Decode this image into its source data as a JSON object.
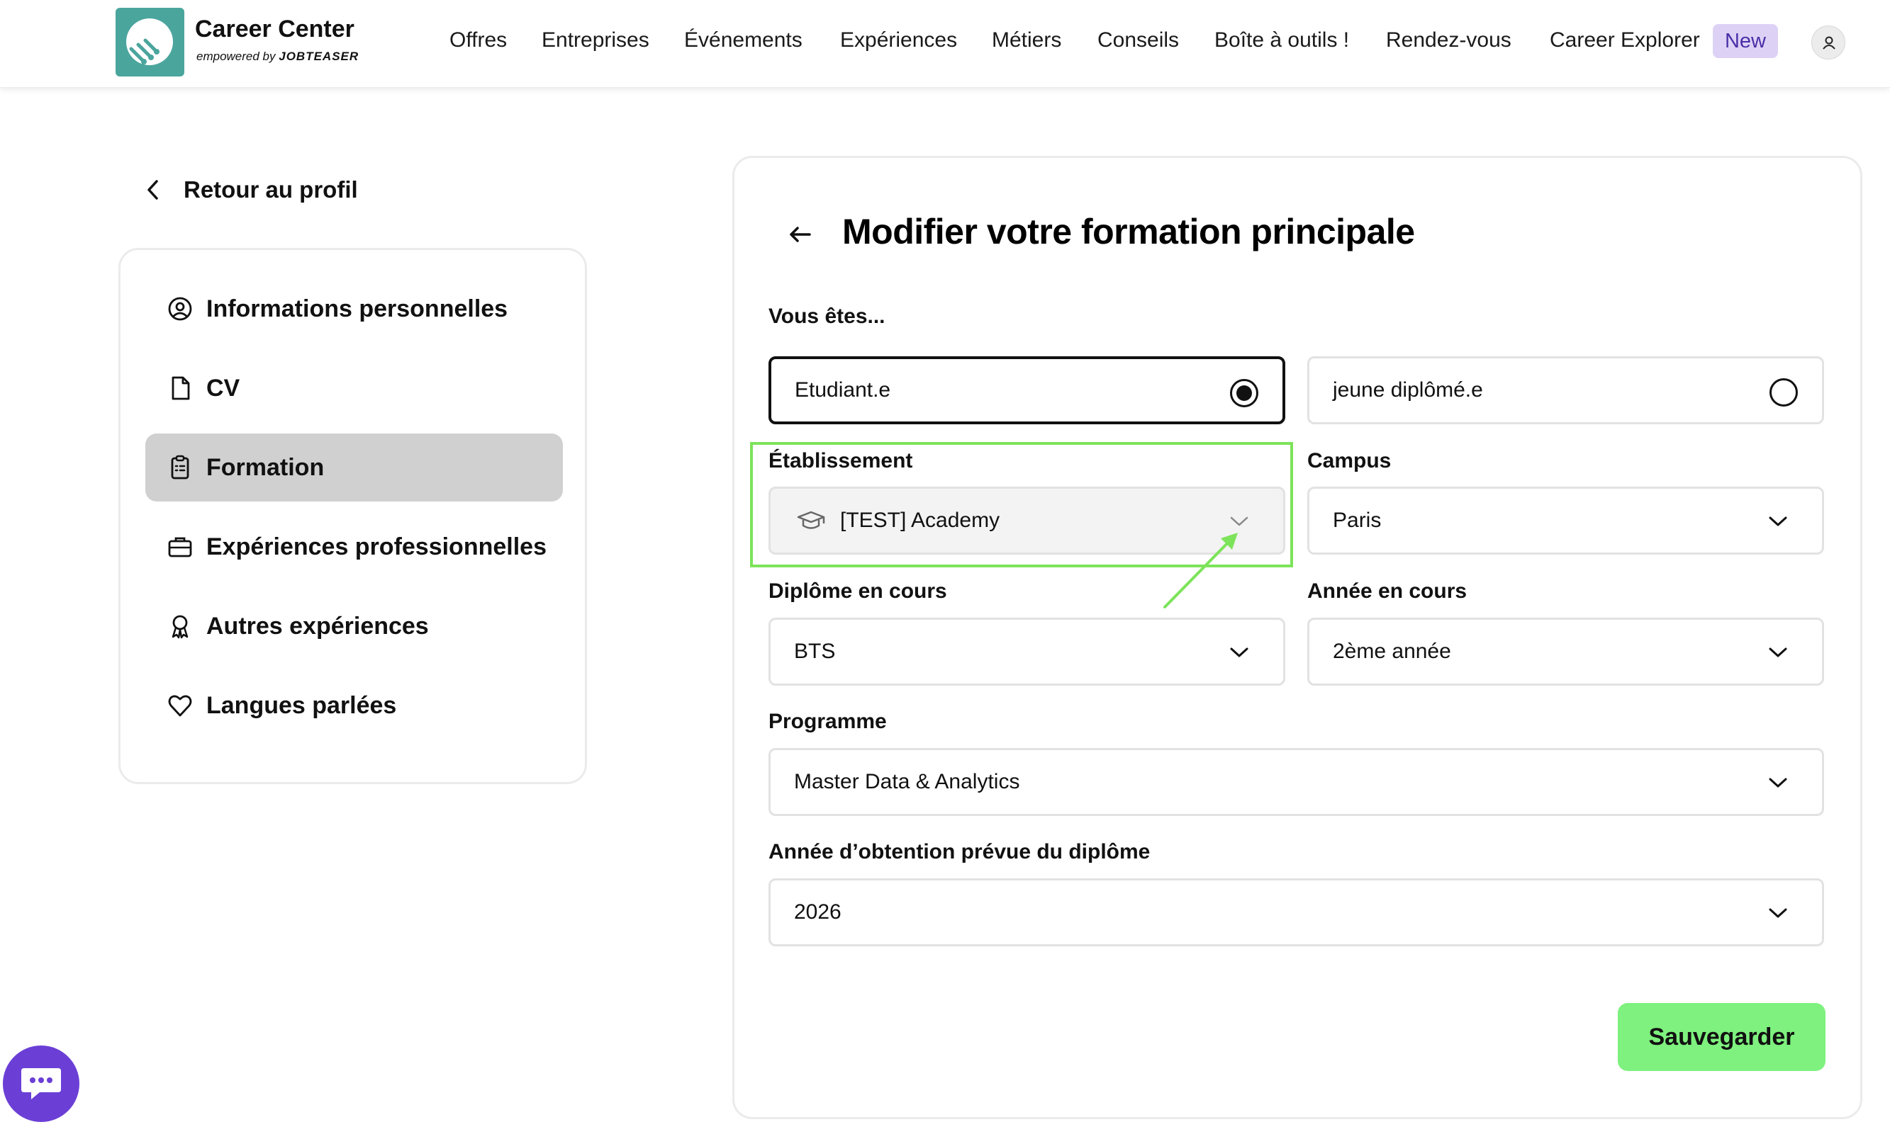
{
  "brand": {
    "title": "Career Center",
    "subtitle_prefix": "empowered by",
    "subtitle_brand": "JOBTEASER",
    "color": "#4aa59d"
  },
  "nav": {
    "items": [
      "Offres",
      "Entreprises",
      "Événements",
      "Expériences",
      "Métiers",
      "Conseils",
      "Boîte à outils !",
      "Rendez-vous",
      "Career Explorer"
    ],
    "new_badge": "New"
  },
  "sidebar": {
    "back_label": "Retour au profil",
    "items": [
      {
        "label": "Informations personnelles",
        "icon": "user-circle-icon",
        "active": false
      },
      {
        "label": "CV",
        "icon": "document-icon",
        "active": false
      },
      {
        "label": "Formation",
        "icon": "clipboard-icon",
        "active": true
      },
      {
        "label": "Expériences professionnelles",
        "icon": "briefcase-icon",
        "active": false
      },
      {
        "label": "Autres expériences",
        "icon": "award-icon",
        "active": false
      },
      {
        "label": "Langues parlées",
        "icon": "heart-icon",
        "active": false
      }
    ]
  },
  "form": {
    "title": "Modifier votre formation principale",
    "status_label": "Vous êtes...",
    "status_options": [
      {
        "label": "Etudiant.e",
        "selected": true
      },
      {
        "label": "jeune diplômé.e",
        "selected": false
      }
    ],
    "etablissement": {
      "label": "Établissement",
      "value": "[TEST] Academy",
      "icon": "graduation-cap-icon"
    },
    "campus": {
      "label": "Campus",
      "value": "Paris"
    },
    "diplome": {
      "label": "Diplôme en cours",
      "value": "BTS"
    },
    "annee": {
      "label": "Année en cours",
      "value": "2ème année"
    },
    "programme": {
      "label": "Programme",
      "value": "Master Data & Analytics"
    },
    "obtention": {
      "label": "Année d’obtention prévue du diplôme",
      "value": "2026"
    },
    "save_label": "Sauvegarder"
  },
  "colors": {
    "save_button": "#7ef17e",
    "highlight": "#7de35a",
    "chat_button": "#6b3fd6",
    "new_badge_bg": "#ddd2f6"
  }
}
